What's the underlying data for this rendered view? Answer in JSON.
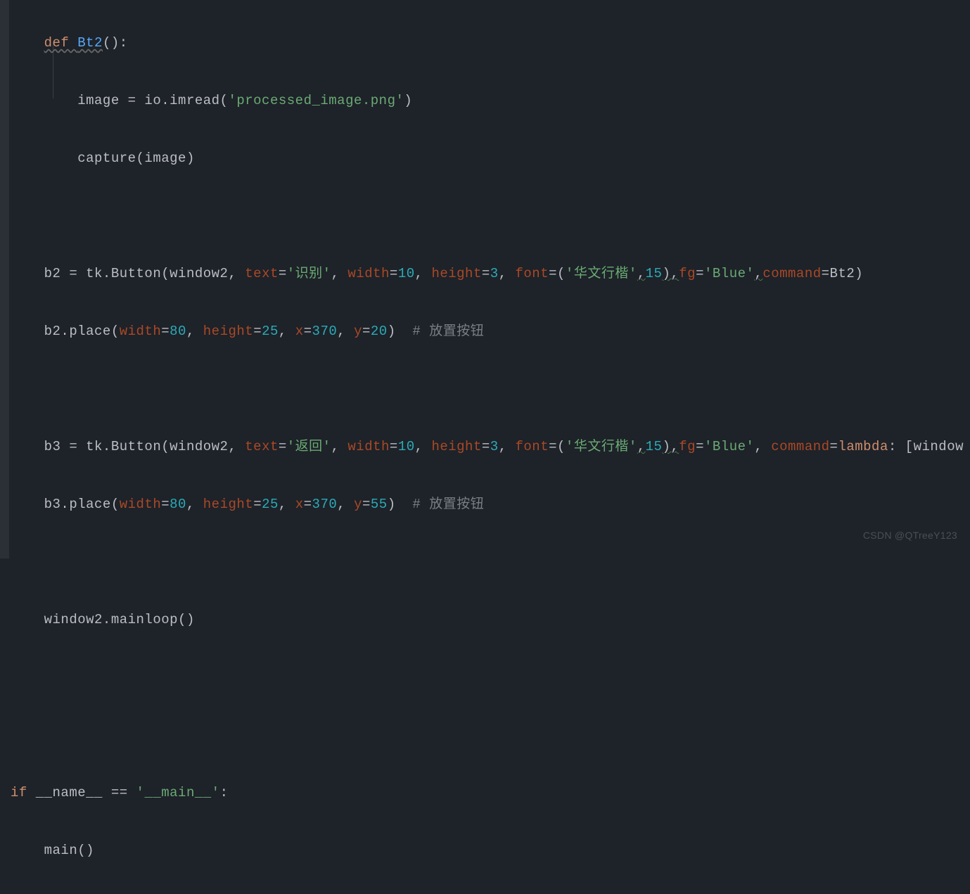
{
  "code": {
    "func_def": {
      "kw": "def",
      "name": "Bt2",
      "parens": "():"
    },
    "l2": {
      "indent": "        ",
      "text1": "image = io.imread(",
      "str": "'processed_image.png'",
      "text2": ")"
    },
    "l3": {
      "indent": "        ",
      "text": "capture(image)"
    },
    "b2_line": {
      "indent": "    ",
      "pre": "b2 = tk.Button(window2, ",
      "k_text": "text",
      "eq1": "=",
      "v_text": "'识别'",
      "c1": ", ",
      "k_width": "width",
      "eq2": "=",
      "v_width": "10",
      "c2": ", ",
      "k_height": "height",
      "eq3": "=",
      "v_height": "3",
      "c3": ", ",
      "k_font": "font",
      "eq4": "=(",
      "v_font_str": "'华文行楷'",
      "v_font_comma": ",",
      "v_font_num": "15",
      "v_font_close": "),",
      "k_fg": "fg",
      "eq5": "=",
      "v_fg": "'Blue'",
      "c5": ",",
      "k_cmd": "command",
      "eq6": "=Bt2)"
    },
    "b2_place": {
      "indent": "    ",
      "pre": "b2.place(",
      "k_width": "width",
      "eq1": "=",
      "v_width": "80",
      "c1": ", ",
      "k_height": "height",
      "eq2": "=",
      "v_height": "25",
      "c2": ", ",
      "k_x": "x",
      "eq3": "=",
      "v_x": "370",
      "c3": ", ",
      "k_y": "y",
      "eq4": "=",
      "v_y": "20",
      "close": ")  ",
      "comment": "# 放置按钮"
    },
    "b3_line": {
      "indent": "    ",
      "pre": "b3 = tk.Button(window2, ",
      "k_text": "text",
      "eq1": "=",
      "v_text": "'返回'",
      "c1": ", ",
      "k_width": "width",
      "eq2": "=",
      "v_width": "10",
      "c2": ", ",
      "k_height": "height",
      "eq3": "=",
      "v_height": "3",
      "c3": ", ",
      "k_font": "font",
      "eq4": "=(",
      "v_font_str": "'华文行楷'",
      "v_font_comma": ",",
      "v_font_num": "15",
      "v_font_close": "),",
      "k_fg": "fg",
      "eq5": "=",
      "v_fg": "'Blue'",
      "c5": ", ",
      "k_cmd": "command",
      "eq6": "=",
      "lambda": "lambda",
      "post_lambda": ": [window"
    },
    "b3_place": {
      "indent": "    ",
      "pre": "b3.place(",
      "k_width": "width",
      "eq1": "=",
      "v_width": "80",
      "c1": ", ",
      "k_height": "height",
      "eq2": "=",
      "v_height": "25",
      "c2": ", ",
      "k_x": "x",
      "eq3": "=",
      "v_x": "370",
      "c3": ", ",
      "k_y": "y",
      "eq4": "=",
      "v_y": "55",
      "close": ")  ",
      "comment": "# 放置按钮"
    },
    "mainloop": {
      "indent": "    ",
      "text": "window2.mainloop()"
    },
    "ifmain": {
      "kw": "if",
      "pre": " __name__ == ",
      "str": "'__main__'",
      "colon": ":"
    },
    "main_call": {
      "indent": "    ",
      "text": "main()"
    }
  },
  "watermark": "CSDN @QTreeY123"
}
